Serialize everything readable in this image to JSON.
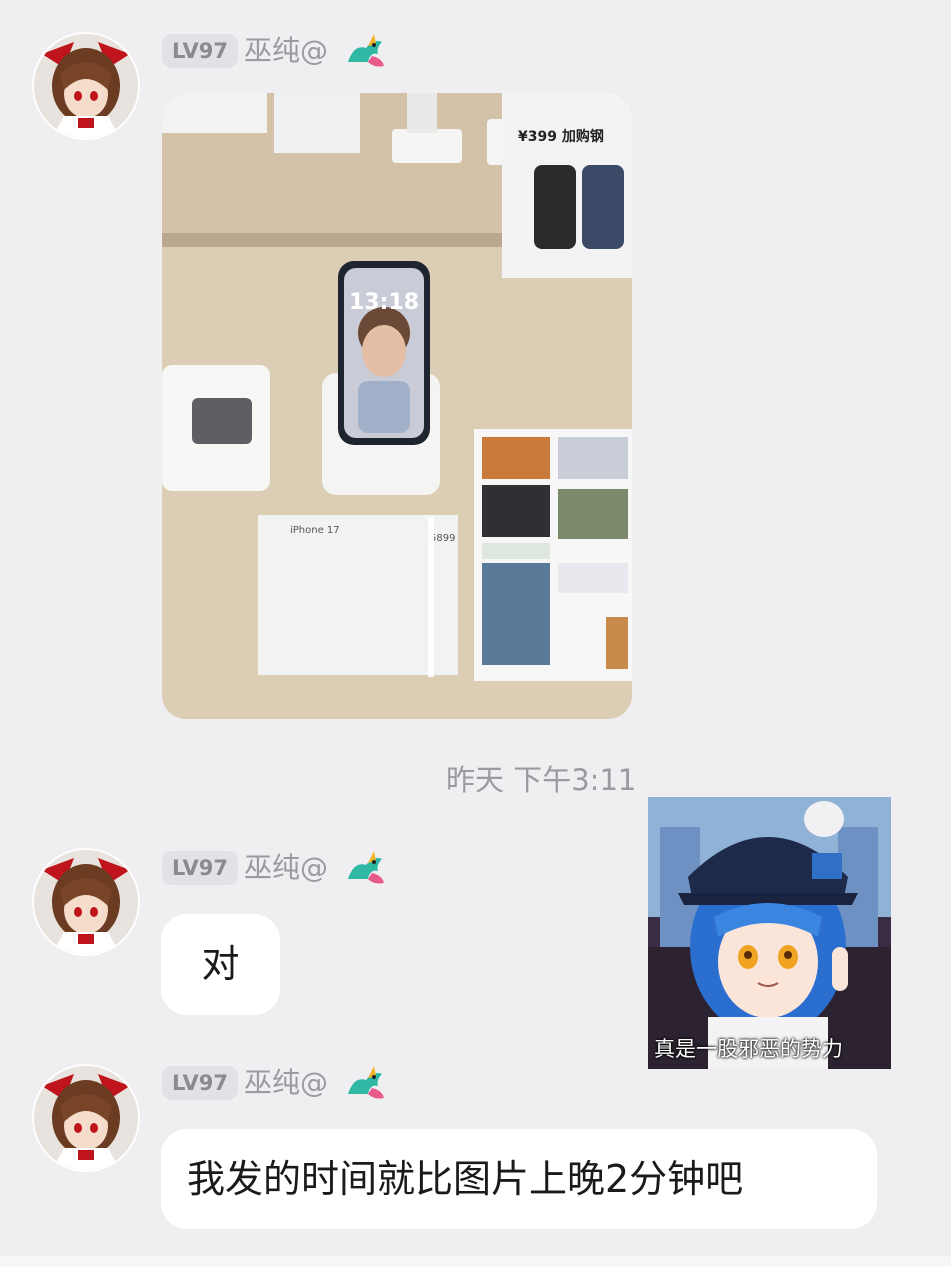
{
  "messages": [
    {
      "level": "LV97",
      "username": "巫纯@",
      "type": "image",
      "image_text": {
        "price": "¥399 加购钢",
        "clock": "13:18",
        "model": "iPhone 17",
        "price_tag": "5899"
      }
    },
    {
      "level": "LV97",
      "username": "巫纯@",
      "type": "text",
      "text": "对"
    },
    {
      "level": "LV97",
      "username": "巫纯@",
      "type": "text",
      "text": "我发的时间就比图片上晚2分钟吧"
    }
  ],
  "timestamp": "昨天 下午3:11",
  "sticker": {
    "caption": "真是一股邪恶的势力"
  },
  "colors": {
    "background": "#efeff1",
    "bubble": "#ffffff",
    "level_badge": "#e2e2e6"
  },
  "icons": [
    "avatar-icon",
    "dragon-badge-icon"
  ]
}
